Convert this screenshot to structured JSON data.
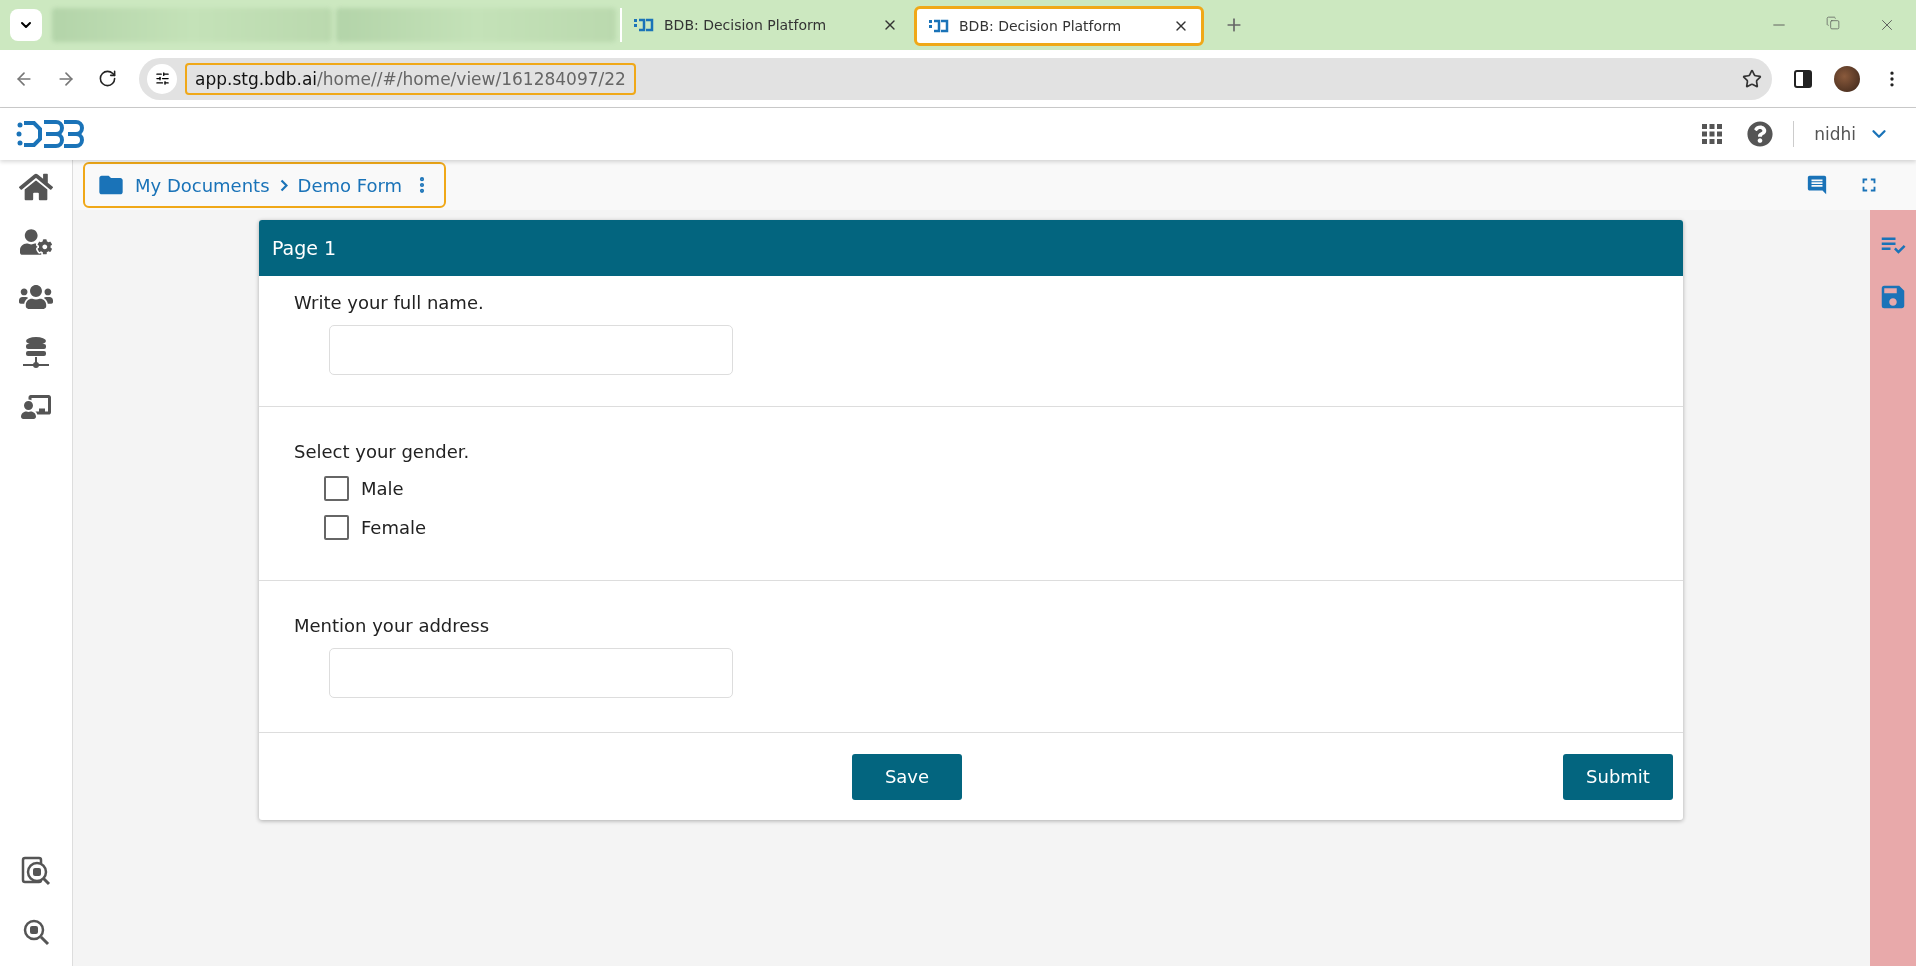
{
  "browser": {
    "tabs": [
      {
        "kind": "blurred",
        "selected": false
      },
      {
        "kind": "blurred",
        "selected": false
      },
      {
        "kind": "page",
        "title": "BDB: Decision Platform",
        "selected": false
      },
      {
        "kind": "page",
        "title": "BDB: Decision Platform",
        "selected": true
      }
    ],
    "url": {
      "host": "app.stg.bdb.ai",
      "path": "/home//#/home/view/161284097/22"
    }
  },
  "header": {
    "user": "nidhi"
  },
  "breadcrumb": [
    "My Documents",
    "Demo Form"
  ],
  "form": {
    "page_title": "Page 1",
    "questions": [
      {
        "kind": "text",
        "label": "Write your full name."
      },
      {
        "kind": "checkboxes",
        "label": "Select your gender.",
        "options": [
          {
            "label": "Male",
            "checked": false
          },
          {
            "label": "Female",
            "checked": false
          }
        ]
      },
      {
        "kind": "text",
        "label": "Mention your address"
      }
    ],
    "buttons": [
      {
        "kind": "center",
        "label": "Save"
      },
      {
        "kind": "end",
        "label": "Submit"
      }
    ]
  }
}
